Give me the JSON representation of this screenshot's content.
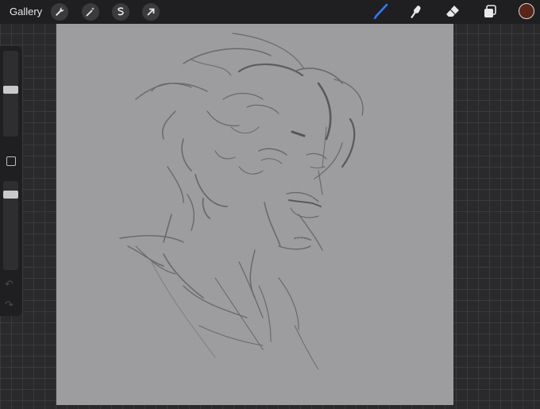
{
  "topbar": {
    "gallery_label": "Gallery",
    "left_tools": [
      "wrench-icon",
      "magic-wand-icon",
      "selection-icon",
      "transform-arrow-icon"
    ],
    "right_tools": [
      "brush-icon",
      "smudge-icon",
      "eraser-icon",
      "layers-icon"
    ],
    "active_tool": "brush-icon",
    "accent_color": "#2f7bff",
    "current_color": "#5a2418"
  },
  "sidebar": {
    "size_slider_level": 0.55,
    "opacity_slider_level": 0.88,
    "undo_icon": "undo-arrow-icon",
    "redo_icon": "redo-arrow-icon"
  },
  "canvas": {
    "background_color": "#9d9d9f",
    "sketch_color": "#6a6a6d"
  }
}
